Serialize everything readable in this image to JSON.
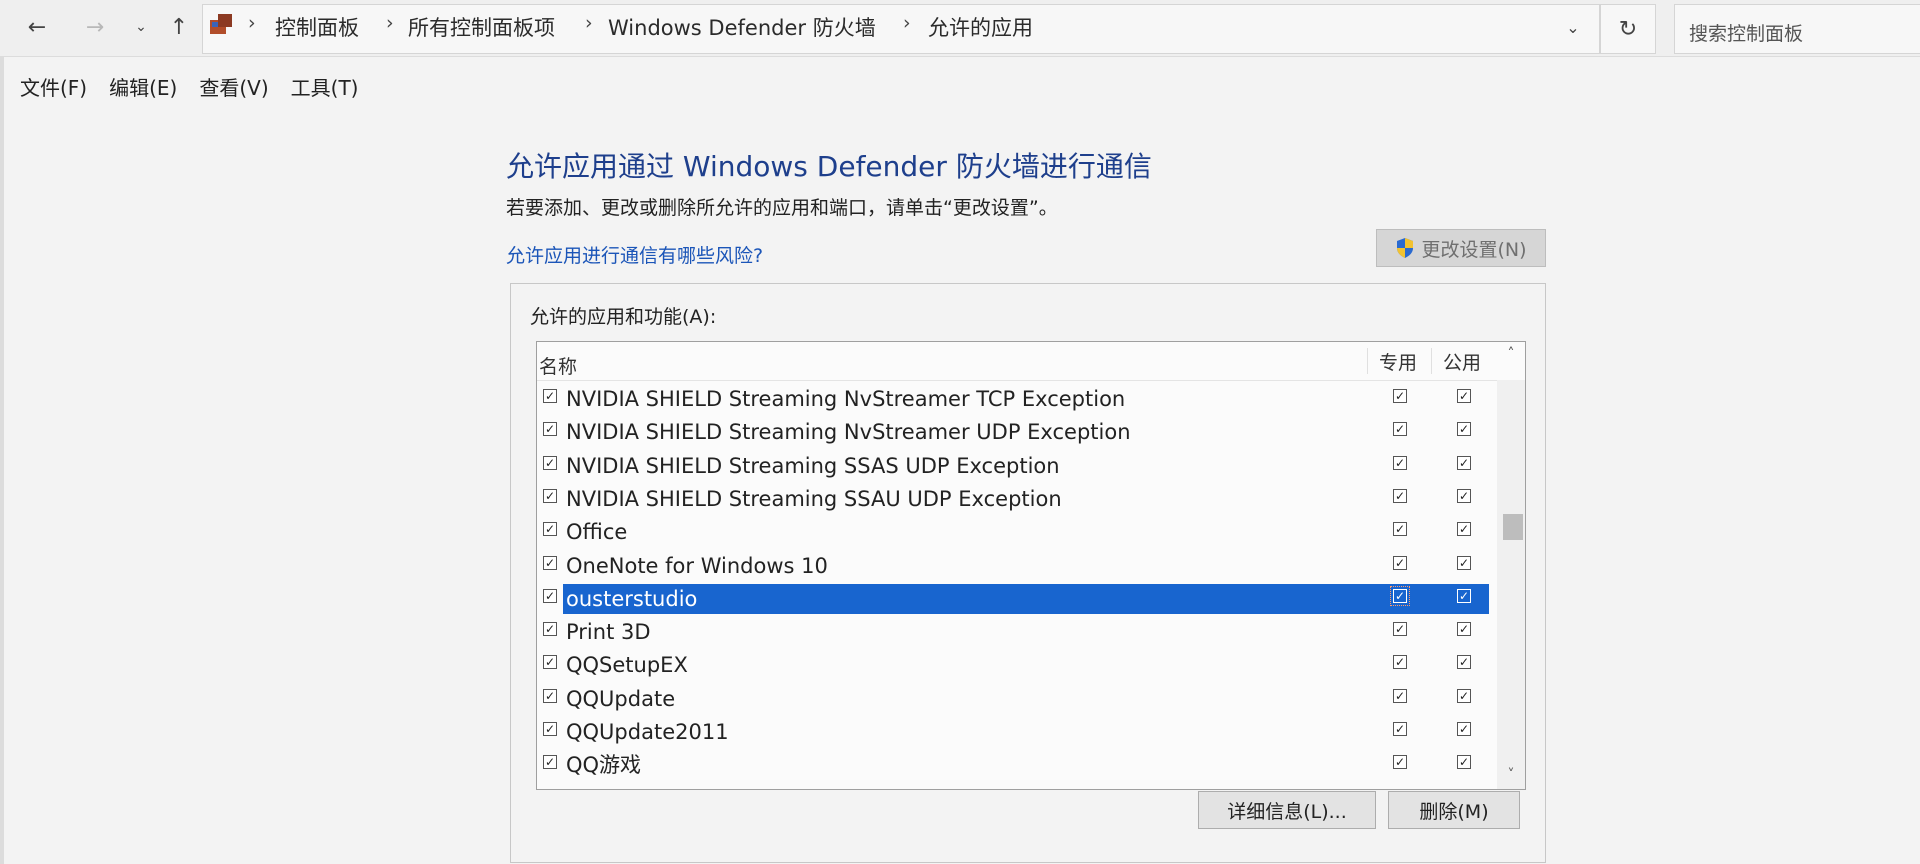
{
  "addressbar": {
    "breadcrumbs": [
      "控制面板",
      "所有控制面板项",
      "Windows Defender 防火墙",
      "允许的应用"
    ],
    "search_placeholder": "搜索控制面板"
  },
  "nav_icons": [
    "back-arrow-icon",
    "forward-arrow-icon",
    "recent-dropdown-icon",
    "up-arrow-icon",
    "refresh-icon",
    "address-dropdown-icon"
  ],
  "menu": [
    "文件(F)",
    "编辑(E)",
    "查看(V)",
    "工具(T)"
  ],
  "main": {
    "title": "允许应用通过 Windows Defender 防火墙进行通信",
    "description": "若要添加、更改或删除所允许的应用和端口，请单击“更改设置”。",
    "risk_link": "允许应用进行通信有哪些风险?",
    "change_settings_label": "更改设置(N)",
    "group_label": "允许的应用和功能(A):",
    "columns": {
      "name": "名称",
      "private": "专用",
      "public": "公用"
    },
    "apps": [
      {
        "name": "NVIDIA SHIELD Streaming NvStreamer TCP Exception",
        "enabled": true,
        "private": true,
        "public": true
      },
      {
        "name": "NVIDIA SHIELD Streaming NvStreamer UDP Exception",
        "enabled": true,
        "private": true,
        "public": true
      },
      {
        "name": "NVIDIA SHIELD Streaming SSAS UDP Exception",
        "enabled": true,
        "private": true,
        "public": true
      },
      {
        "name": "NVIDIA SHIELD Streaming SSAU UDP Exception",
        "enabled": true,
        "private": true,
        "public": true
      },
      {
        "name": "Office",
        "enabled": true,
        "private": true,
        "public": true
      },
      {
        "name": "OneNote for Windows 10",
        "enabled": true,
        "private": true,
        "public": true
      },
      {
        "name": "ousterstudio",
        "enabled": true,
        "private": true,
        "public": true,
        "selected": true
      },
      {
        "name": "Print 3D",
        "enabled": true,
        "private": true,
        "public": true
      },
      {
        "name": "QQSetupEX",
        "enabled": true,
        "private": true,
        "public": true
      },
      {
        "name": "QQUpdate",
        "enabled": true,
        "private": true,
        "public": true
      },
      {
        "name": "QQUpdate2011",
        "enabled": true,
        "private": true,
        "public": true
      },
      {
        "name": "QQ游戏",
        "enabled": true,
        "private": true,
        "public": true
      }
    ],
    "details_button": "详细信息(L)...",
    "delete_button": "删除(M)"
  },
  "colors": {
    "title": "#1e3f8c",
    "link": "#1b55b8",
    "selection": "#1865cf"
  }
}
